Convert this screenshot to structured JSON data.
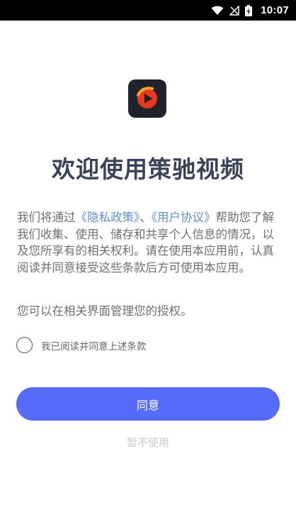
{
  "status_bar": {
    "time": "10:07",
    "icons": [
      "wifi-icon",
      "no-signal-icon",
      "battery-charging-icon"
    ]
  },
  "app": {
    "logo_icon": "play-logo-icon",
    "title": "欢迎使用策驰视频"
  },
  "intro": {
    "before_links": "我们将通过",
    "privacy_link": "《隐私政策》",
    "separator": "、",
    "agreement_link": "《用户协议》",
    "after_links": "帮助您了解我们收集、使用、储存和共享个人信息的情况，以及您所享有的相关权利。请在使用本应用前，认真阅读并同意接受这些条款后方可使用本应用。",
    "second_paragraph": "您可以在相关界面管理您的授权。"
  },
  "agree_checkbox": {
    "label": "我已阅读并同意上述条款",
    "checked": false
  },
  "buttons": {
    "agree": "同意",
    "decline": "暂不使用"
  },
  "colors": {
    "primary": "#556bf9",
    "link": "#5f8fd6",
    "title": "#3a4256",
    "logo_bg": "#20232b",
    "logo_accent": "#e8381e",
    "logo_ring": "#f5a623"
  }
}
